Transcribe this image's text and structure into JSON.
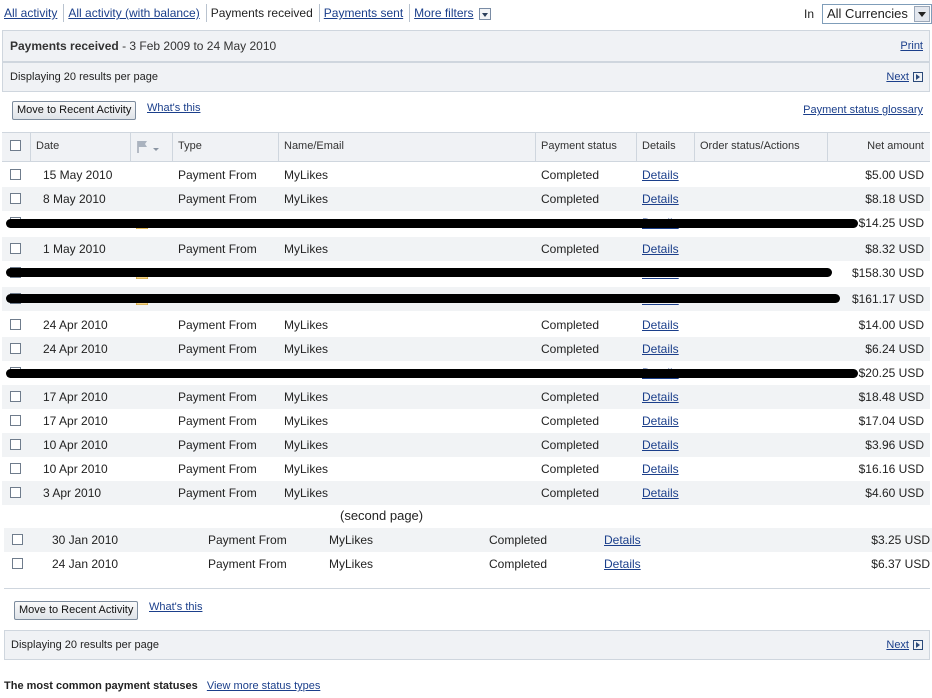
{
  "tabs": {
    "all_activity": "All activity",
    "all_activity_balance": "All activity (with balance)",
    "payments_received": "Payments received",
    "payments_sent": "Payments sent",
    "more_filters": "More filters"
  },
  "currency": {
    "label": "In",
    "value": "All Currencies"
  },
  "header": {
    "title": "Payments received",
    "range": " - 3 Feb 2009 to 24 May 2010",
    "print": "Print"
  },
  "paging": {
    "display_text": "Displaying 20 results per page",
    "next": "Next"
  },
  "actions": {
    "move_button": "Move to Recent Activity",
    "whats_this": "What's this",
    "glossary": "Payment status glossary"
  },
  "columns": {
    "date": "Date",
    "type": "Type",
    "name": "Name/Email",
    "status": "Payment status",
    "details": "Details",
    "order": "Order status/Actions",
    "amount": "Net amount"
  },
  "rows": [
    {
      "date": "15 May 2010",
      "type": "Payment From",
      "name": "MyLikes",
      "status": "Completed",
      "details": "Details",
      "amount": "$5.00 USD"
    },
    {
      "date": "8 May 2010",
      "type": "Payment From",
      "name": "MyLikes",
      "status": "Completed",
      "details": "Details",
      "amount": "$8.18 USD"
    },
    {
      "date": "",
      "type": "",
      "name": "",
      "status": "",
      "details": "Details",
      "amount": "$14.25 USD"
    },
    {
      "date": "1 May 2010",
      "type": "Payment From",
      "name": "MyLikes",
      "status": "Completed",
      "details": "Details",
      "amount": "$8.32 USD"
    },
    {
      "date": "",
      "type": "",
      "name": "",
      "status": "",
      "details": "Details",
      "amount": "$158.30 USD"
    },
    {
      "date": "",
      "type": "",
      "name": "",
      "status": "",
      "details": "Details",
      "amount": "$161.17 USD"
    },
    {
      "date": "24 Apr 2010",
      "type": "Payment From",
      "name": "MyLikes",
      "status": "Completed",
      "details": "Details",
      "amount": "$14.00 USD"
    },
    {
      "date": "24 Apr 2010",
      "type": "Payment From",
      "name": "MyLikes",
      "status": "Completed",
      "details": "Details",
      "amount": "$6.24 USD"
    },
    {
      "date": "",
      "type": "",
      "name": "",
      "status": "",
      "details": "Details",
      "amount": "$20.25 USD"
    },
    {
      "date": "17 Apr 2010",
      "type": "Payment From",
      "name": "MyLikes",
      "status": "Completed",
      "details": "Details",
      "amount": "$18.48 USD"
    },
    {
      "date": "17 Apr 2010",
      "type": "Payment From",
      "name": "MyLikes",
      "status": "Completed",
      "details": "Details",
      "amount": "$17.04 USD"
    },
    {
      "date": "10 Apr 2010",
      "type": "Payment From",
      "name": "MyLikes",
      "status": "Completed",
      "details": "Details",
      "amount": "$3.96 USD"
    },
    {
      "date": "10 Apr 2010",
      "type": "Payment From",
      "name": "MyLikes",
      "status": "Completed",
      "details": "Details",
      "amount": "$16.16 USD"
    },
    {
      "date": "3 Apr 2010",
      "type": "Payment From",
      "name": "MyLikes",
      "status": "Completed",
      "details": "Details",
      "amount": "$4.60 USD"
    }
  ],
  "second_page_label": "(second page)",
  "rows2": [
    {
      "date": "30 Jan 2010",
      "type": "Payment From",
      "name": "MyLikes",
      "status": "Completed",
      "details": "Details",
      "amount": "$3.25 USD"
    },
    {
      "date": "24 Jan 2010",
      "type": "Payment From",
      "name": "MyLikes",
      "status": "Completed",
      "details": "Details",
      "amount": "$6.37 USD"
    }
  ],
  "footer": {
    "common_statuses": "The most common payment statuses",
    "view_more": "View more status types"
  }
}
